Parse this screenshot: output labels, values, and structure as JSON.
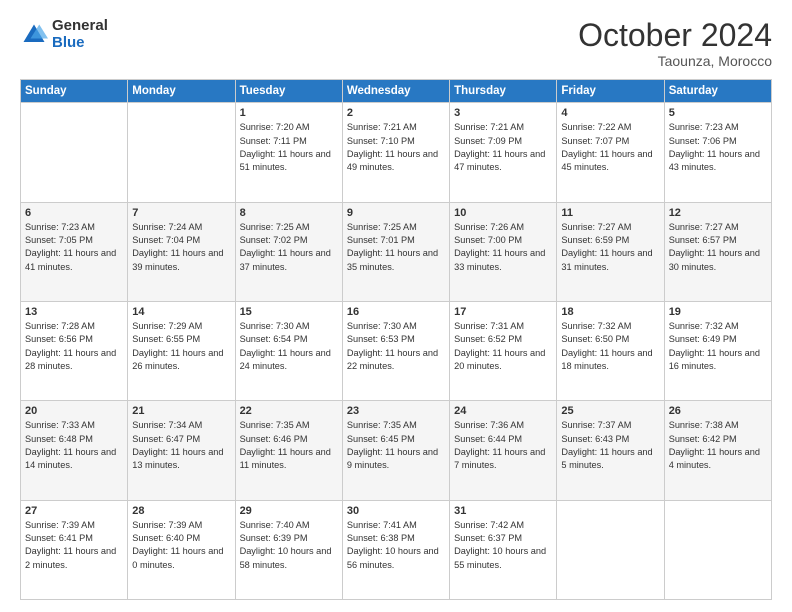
{
  "header": {
    "logo_line1": "General",
    "logo_line2": "Blue",
    "month": "October 2024",
    "location": "Taounza, Morocco"
  },
  "days_of_week": [
    "Sunday",
    "Monday",
    "Tuesday",
    "Wednesday",
    "Thursday",
    "Friday",
    "Saturday"
  ],
  "weeks": [
    [
      {
        "day": "",
        "info": ""
      },
      {
        "day": "",
        "info": ""
      },
      {
        "day": "1",
        "info": "Sunrise: 7:20 AM\nSunset: 7:11 PM\nDaylight: 11 hours and 51 minutes."
      },
      {
        "day": "2",
        "info": "Sunrise: 7:21 AM\nSunset: 7:10 PM\nDaylight: 11 hours and 49 minutes."
      },
      {
        "day": "3",
        "info": "Sunrise: 7:21 AM\nSunset: 7:09 PM\nDaylight: 11 hours and 47 minutes."
      },
      {
        "day": "4",
        "info": "Sunrise: 7:22 AM\nSunset: 7:07 PM\nDaylight: 11 hours and 45 minutes."
      },
      {
        "day": "5",
        "info": "Sunrise: 7:23 AM\nSunset: 7:06 PM\nDaylight: 11 hours and 43 minutes."
      }
    ],
    [
      {
        "day": "6",
        "info": "Sunrise: 7:23 AM\nSunset: 7:05 PM\nDaylight: 11 hours and 41 minutes."
      },
      {
        "day": "7",
        "info": "Sunrise: 7:24 AM\nSunset: 7:04 PM\nDaylight: 11 hours and 39 minutes."
      },
      {
        "day": "8",
        "info": "Sunrise: 7:25 AM\nSunset: 7:02 PM\nDaylight: 11 hours and 37 minutes."
      },
      {
        "day": "9",
        "info": "Sunrise: 7:25 AM\nSunset: 7:01 PM\nDaylight: 11 hours and 35 minutes."
      },
      {
        "day": "10",
        "info": "Sunrise: 7:26 AM\nSunset: 7:00 PM\nDaylight: 11 hours and 33 minutes."
      },
      {
        "day": "11",
        "info": "Sunrise: 7:27 AM\nSunset: 6:59 PM\nDaylight: 11 hours and 31 minutes."
      },
      {
        "day": "12",
        "info": "Sunrise: 7:27 AM\nSunset: 6:57 PM\nDaylight: 11 hours and 30 minutes."
      }
    ],
    [
      {
        "day": "13",
        "info": "Sunrise: 7:28 AM\nSunset: 6:56 PM\nDaylight: 11 hours and 28 minutes."
      },
      {
        "day": "14",
        "info": "Sunrise: 7:29 AM\nSunset: 6:55 PM\nDaylight: 11 hours and 26 minutes."
      },
      {
        "day": "15",
        "info": "Sunrise: 7:30 AM\nSunset: 6:54 PM\nDaylight: 11 hours and 24 minutes."
      },
      {
        "day": "16",
        "info": "Sunrise: 7:30 AM\nSunset: 6:53 PM\nDaylight: 11 hours and 22 minutes."
      },
      {
        "day": "17",
        "info": "Sunrise: 7:31 AM\nSunset: 6:52 PM\nDaylight: 11 hours and 20 minutes."
      },
      {
        "day": "18",
        "info": "Sunrise: 7:32 AM\nSunset: 6:50 PM\nDaylight: 11 hours and 18 minutes."
      },
      {
        "day": "19",
        "info": "Sunrise: 7:32 AM\nSunset: 6:49 PM\nDaylight: 11 hours and 16 minutes."
      }
    ],
    [
      {
        "day": "20",
        "info": "Sunrise: 7:33 AM\nSunset: 6:48 PM\nDaylight: 11 hours and 14 minutes."
      },
      {
        "day": "21",
        "info": "Sunrise: 7:34 AM\nSunset: 6:47 PM\nDaylight: 11 hours and 13 minutes."
      },
      {
        "day": "22",
        "info": "Sunrise: 7:35 AM\nSunset: 6:46 PM\nDaylight: 11 hours and 11 minutes."
      },
      {
        "day": "23",
        "info": "Sunrise: 7:35 AM\nSunset: 6:45 PM\nDaylight: 11 hours and 9 minutes."
      },
      {
        "day": "24",
        "info": "Sunrise: 7:36 AM\nSunset: 6:44 PM\nDaylight: 11 hours and 7 minutes."
      },
      {
        "day": "25",
        "info": "Sunrise: 7:37 AM\nSunset: 6:43 PM\nDaylight: 11 hours and 5 minutes."
      },
      {
        "day": "26",
        "info": "Sunrise: 7:38 AM\nSunset: 6:42 PM\nDaylight: 11 hours and 4 minutes."
      }
    ],
    [
      {
        "day": "27",
        "info": "Sunrise: 7:39 AM\nSunset: 6:41 PM\nDaylight: 11 hours and 2 minutes."
      },
      {
        "day": "28",
        "info": "Sunrise: 7:39 AM\nSunset: 6:40 PM\nDaylight: 11 hours and 0 minutes."
      },
      {
        "day": "29",
        "info": "Sunrise: 7:40 AM\nSunset: 6:39 PM\nDaylight: 10 hours and 58 minutes."
      },
      {
        "day": "30",
        "info": "Sunrise: 7:41 AM\nSunset: 6:38 PM\nDaylight: 10 hours and 56 minutes."
      },
      {
        "day": "31",
        "info": "Sunrise: 7:42 AM\nSunset: 6:37 PM\nDaylight: 10 hours and 55 minutes."
      },
      {
        "day": "",
        "info": ""
      },
      {
        "day": "",
        "info": ""
      }
    ]
  ]
}
